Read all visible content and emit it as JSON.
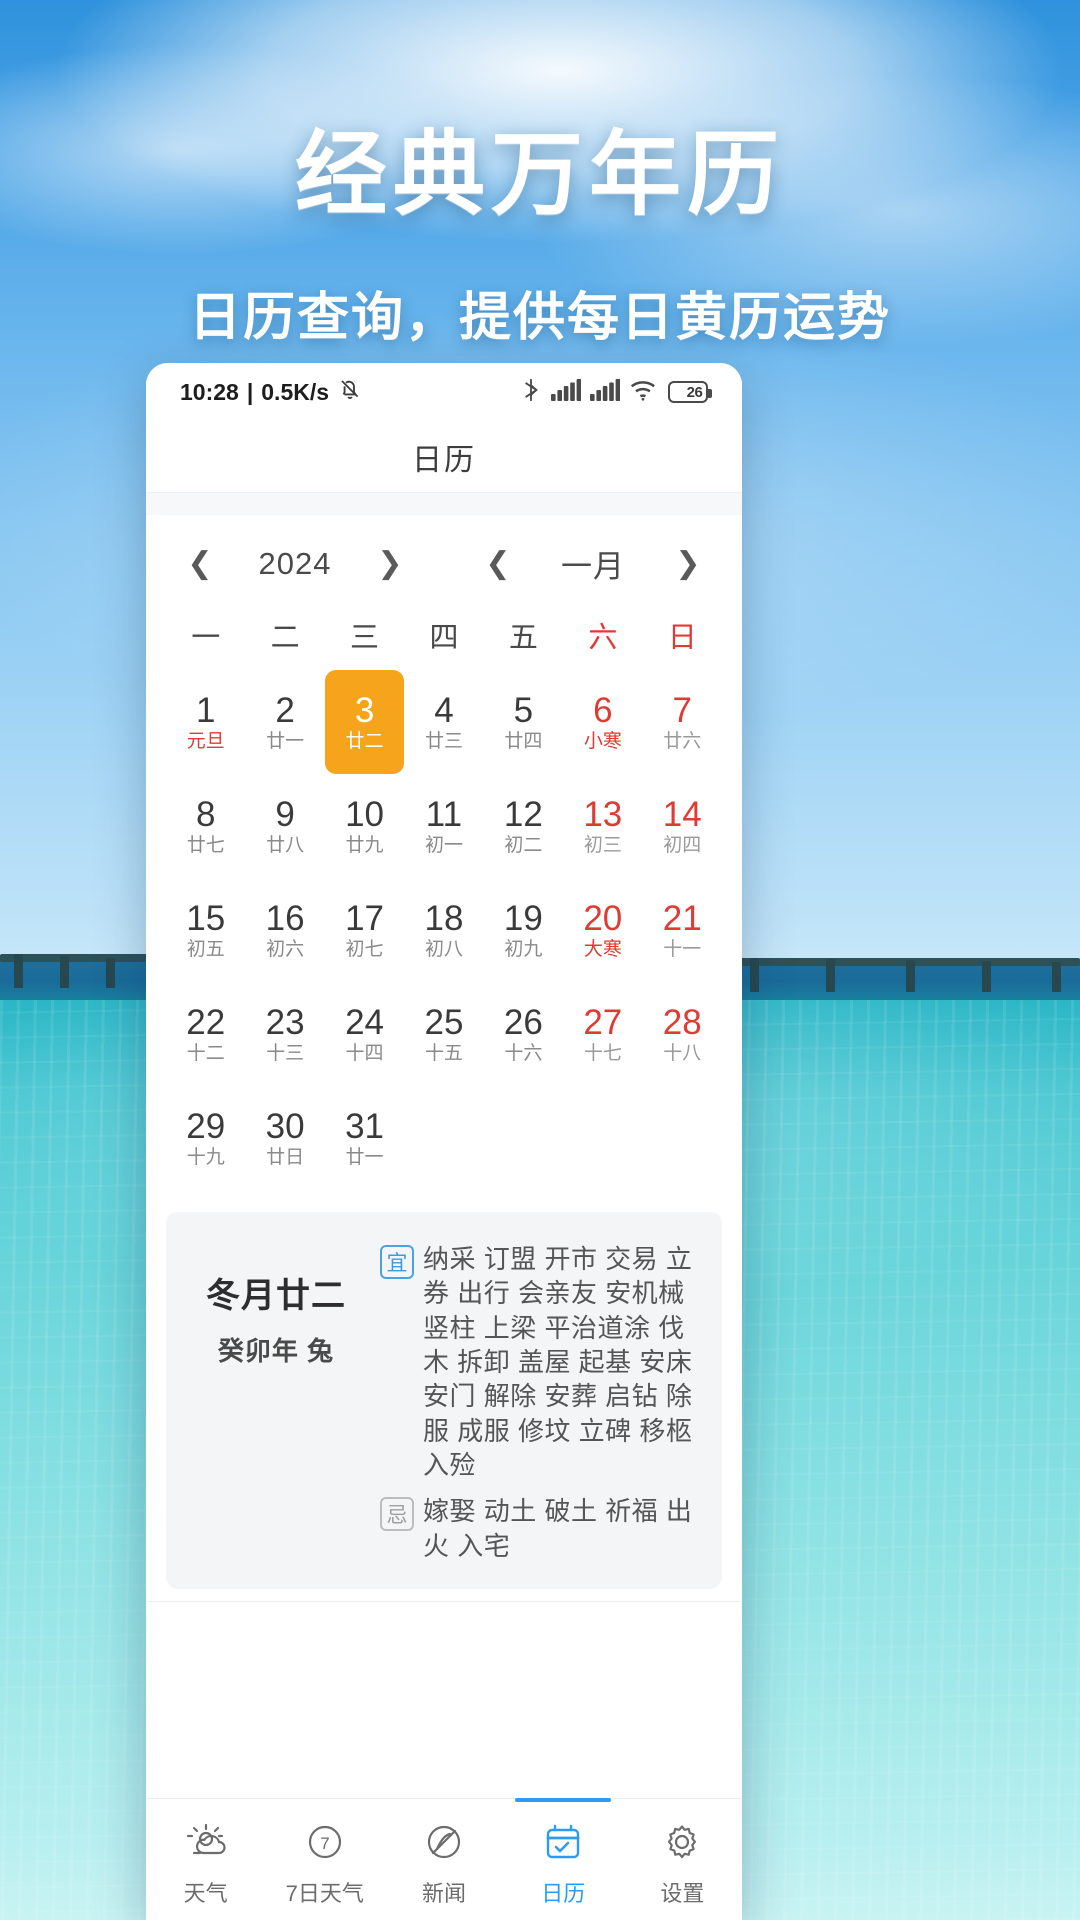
{
  "promo": {
    "title": "经典万年历",
    "subtitle": "日历查询，提供每日黄历运势"
  },
  "colors": {
    "accent_selected": "#f5a41b",
    "accent_tab_active": "#2d9cf0",
    "weekend_red": "#e03b32",
    "badge_yi": "#4aa3e0",
    "badge_ji": "#bdbdbd"
  },
  "statusbar": {
    "time": "10:28",
    "separator": "|",
    "net_speed": "0.5K/s",
    "mute_icon": "bell-muted-icon",
    "bluetooth_icon": "bluetooth-icon",
    "signal1_icon": "signal-bars-icon",
    "signal2_icon": "signal-bars-icon",
    "wifi_icon": "wifi-icon",
    "battery_level": "26"
  },
  "titlebar": {
    "title": "日历"
  },
  "monthnav": {
    "year_prev_icon": "chevron-left-icon",
    "year_value": "2024",
    "year_next_icon": "chevron-right-icon",
    "month_prev_icon": "chevron-left-icon",
    "month_value": "一月",
    "month_next_icon": "chevron-right-icon"
  },
  "calendar": {
    "weekdays": [
      {
        "label": "一",
        "weekend": false
      },
      {
        "label": "二",
        "weekend": false
      },
      {
        "label": "三",
        "weekend": false
      },
      {
        "label": "四",
        "weekend": false
      },
      {
        "label": "五",
        "weekend": false
      },
      {
        "label": "六",
        "weekend": true
      },
      {
        "label": "日",
        "weekend": true
      }
    ],
    "weeks": [
      [
        {
          "day": "1",
          "sub": "元旦",
          "festival": true,
          "weekend": false,
          "selected": false
        },
        {
          "day": "2",
          "sub": "廿一",
          "festival": false,
          "weekend": false,
          "selected": false
        },
        {
          "day": "3",
          "sub": "廿二",
          "festival": false,
          "weekend": false,
          "selected": true
        },
        {
          "day": "4",
          "sub": "廿三",
          "festival": false,
          "weekend": false,
          "selected": false
        },
        {
          "day": "5",
          "sub": "廿四",
          "festival": false,
          "weekend": false,
          "selected": false
        },
        {
          "day": "6",
          "sub": "小寒",
          "festival": true,
          "weekend": true,
          "selected": false
        },
        {
          "day": "7",
          "sub": "廿六",
          "festival": false,
          "weekend": true,
          "selected": false
        }
      ],
      [
        {
          "day": "8",
          "sub": "廿七",
          "festival": false,
          "weekend": false,
          "selected": false
        },
        {
          "day": "9",
          "sub": "廿八",
          "festival": false,
          "weekend": false,
          "selected": false
        },
        {
          "day": "10",
          "sub": "廿九",
          "festival": false,
          "weekend": false,
          "selected": false
        },
        {
          "day": "11",
          "sub": "初一",
          "festival": false,
          "weekend": false,
          "selected": false
        },
        {
          "day": "12",
          "sub": "初二",
          "festival": false,
          "weekend": false,
          "selected": false
        },
        {
          "day": "13",
          "sub": "初三",
          "festival": false,
          "weekend": true,
          "selected": false
        },
        {
          "day": "14",
          "sub": "初四",
          "festival": false,
          "weekend": true,
          "selected": false
        }
      ],
      [
        {
          "day": "15",
          "sub": "初五",
          "festival": false,
          "weekend": false,
          "selected": false
        },
        {
          "day": "16",
          "sub": "初六",
          "festival": false,
          "weekend": false,
          "selected": false
        },
        {
          "day": "17",
          "sub": "初七",
          "festival": false,
          "weekend": false,
          "selected": false
        },
        {
          "day": "18",
          "sub": "初八",
          "festival": false,
          "weekend": false,
          "selected": false
        },
        {
          "day": "19",
          "sub": "初九",
          "festival": false,
          "weekend": false,
          "selected": false
        },
        {
          "day": "20",
          "sub": "大寒",
          "festival": true,
          "weekend": true,
          "selected": false
        },
        {
          "day": "21",
          "sub": "十一",
          "festival": false,
          "weekend": true,
          "selected": false
        }
      ],
      [
        {
          "day": "22",
          "sub": "十二",
          "festival": false,
          "weekend": false,
          "selected": false
        },
        {
          "day": "23",
          "sub": "十三",
          "festival": false,
          "weekend": false,
          "selected": false
        },
        {
          "day": "24",
          "sub": "十四",
          "festival": false,
          "weekend": false,
          "selected": false
        },
        {
          "day": "25",
          "sub": "十五",
          "festival": false,
          "weekend": false,
          "selected": false
        },
        {
          "day": "26",
          "sub": "十六",
          "festival": false,
          "weekend": false,
          "selected": false
        },
        {
          "day": "27",
          "sub": "十七",
          "festival": false,
          "weekend": true,
          "selected": false
        },
        {
          "day": "28",
          "sub": "十八",
          "festival": false,
          "weekend": true,
          "selected": false
        }
      ],
      [
        {
          "day": "29",
          "sub": "十九",
          "festival": false,
          "weekend": false,
          "selected": false
        },
        {
          "day": "30",
          "sub": "廿日",
          "festival": false,
          "weekend": false,
          "selected": false
        },
        {
          "day": "31",
          "sub": "廿一",
          "festival": false,
          "weekend": false,
          "selected": false
        },
        {
          "day": "",
          "sub": "",
          "festival": false,
          "weekend": false,
          "selected": false
        },
        {
          "day": "",
          "sub": "",
          "festival": false,
          "weekend": false,
          "selected": false
        },
        {
          "day": "",
          "sub": "",
          "festival": false,
          "weekend": false,
          "selected": false
        },
        {
          "day": "",
          "sub": "",
          "festival": false,
          "weekend": false,
          "selected": false
        }
      ]
    ]
  },
  "almanac": {
    "lunar_date": "冬月廿二",
    "ganzhi_year": "癸卯年 兔",
    "yi_badge": "宜",
    "yi_text": "纳采 订盟 开市 交易 立券 出行 会亲友 安机械 竖柱 上梁 平治道涂 伐木 拆卸 盖屋 起基 安床 安门 解除 安葬 启钻 除服 成服 修坟 立碑 移柩 入殓",
    "ji_badge": "忌",
    "ji_text": "嫁娶 动土 破土 祈福 出火 入宅"
  },
  "tabbar": {
    "tabs": [
      {
        "label": "天气",
        "icon": "sun-cloud-icon",
        "active": false
      },
      {
        "label": "7日天气",
        "icon": "seven-day-icon",
        "active": false
      },
      {
        "label": "新闻",
        "icon": "news-slash-icon",
        "active": false
      },
      {
        "label": "日历",
        "icon": "calendar-icon",
        "active": true
      },
      {
        "label": "设置",
        "icon": "gear-icon",
        "active": false
      }
    ]
  }
}
